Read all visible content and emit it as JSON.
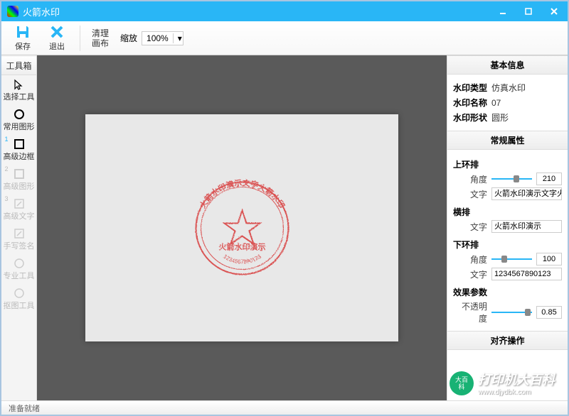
{
  "title_bar": {
    "title": "火箭水印"
  },
  "toolbar": {
    "save_label": "保存",
    "exit_label": "退出",
    "clear_label_l1": "清理",
    "clear_label_l2": "画布",
    "zoom_label": "缩放",
    "zoom_value": "100%"
  },
  "toolbox": {
    "header": "工具箱",
    "items": [
      {
        "label": "选择工具"
      },
      {
        "label": "常用图形"
      },
      {
        "label": "高级边框"
      },
      {
        "label": "高级图形"
      },
      {
        "label": "高级文字"
      },
      {
        "label": "手写签名"
      },
      {
        "label": "专业工具"
      },
      {
        "label": "抠图工具"
      }
    ]
  },
  "side": {
    "basic_hdr": "基本信息",
    "basic": {
      "type_k": "水印类型",
      "type_v": "仿真水印",
      "name_k": "水印名称",
      "name_v": "07",
      "shape_k": "水印形状",
      "shape_v": "圆形"
    },
    "normal_hdr": "常规属性",
    "top_ring": "上环排",
    "top_angle_label": "角度",
    "top_angle_value": "210",
    "top_text_label": "文字",
    "top_text_value": "火箭水印演示文字火箭水印",
    "horiz": "横排",
    "horiz_text_label": "文字",
    "horiz_text_value": "火箭水印演示",
    "bottom_ring": "下环排",
    "bottom_angle_label": "角度",
    "bottom_angle_value": "100",
    "bottom_text_label": "文字",
    "bottom_text_value": "1234567890123",
    "effect": "效果参数",
    "opacity_label": "不透明度",
    "opacity_value": "0.85",
    "align_hdr": "对齐操作"
  },
  "stamp": {
    "top_text": "火箭水印演示文字火箭水印",
    "center_text": "火箭水印演示",
    "bottom_text": "1234567890123",
    "color": "#d83a3a"
  },
  "status": {
    "text": "准备就绪"
  },
  "watermark": {
    "text": "打印机大百科",
    "url": "www.djydbk.com"
  }
}
